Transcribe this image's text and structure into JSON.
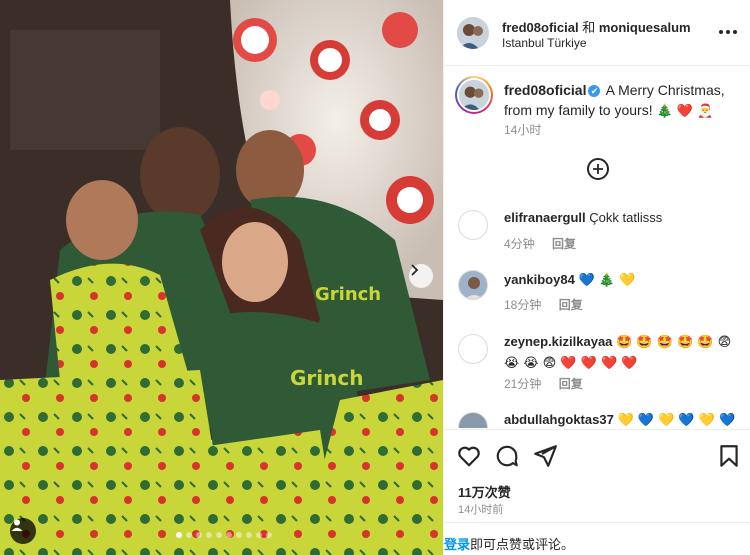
{
  "post": {
    "authors": "fred08oficial",
    "and": "和",
    "coauthor": "moniquesalum",
    "location": "Istanbul Türkiye"
  },
  "caption": {
    "username": "fred08oficial",
    "verified": "✔",
    "text": "A Merry Christmas, from my family to yours!",
    "emojis": "🎄 ❤️ 🎅",
    "time": "14小时"
  },
  "comments": [
    {
      "username": "elifranaergull",
      "text": "Çokk tatlisss",
      "time": "4分钟",
      "reply": "回复"
    },
    {
      "username": "yankiboy84",
      "text": "💙 🎄 💛",
      "time": "18分钟",
      "reply": "回复"
    },
    {
      "username": "zeynep.kizilkayaa",
      "text": "🤩 🤩 🤩 🤩 🤩 😨 😭 😭 😨 ❤️ ❤️ ❤️ ❤️",
      "time": "21分钟",
      "reply": "回复"
    },
    {
      "username": "abdullahgoktas37",
      "text": "💛 💙 💛 💙 💛 💙",
      "time": "",
      "reply": ""
    }
  ],
  "stats": {
    "likes": "11万次赞",
    "time": "14小时前"
  },
  "login": {
    "link": "登录",
    "rest": "即可点赞或评论。"
  },
  "icons": {
    "next": "chevron-right-icon",
    "tag": "user-tag-icon",
    "more": "more-horizontal-icon",
    "load_more": "plus-circle-icon",
    "like": "heart-icon",
    "comment": "comment-icon",
    "share": "send-icon",
    "save": "bookmark-icon"
  },
  "colors": {
    "link": "#0095f6",
    "verified": "#3897f0",
    "muted": "#8e8e8e",
    "pajama_green": "#2f5a35",
    "pajama_yellow": "#c8d63a"
  },
  "carousel": {
    "slides": 10,
    "current": 1
  }
}
